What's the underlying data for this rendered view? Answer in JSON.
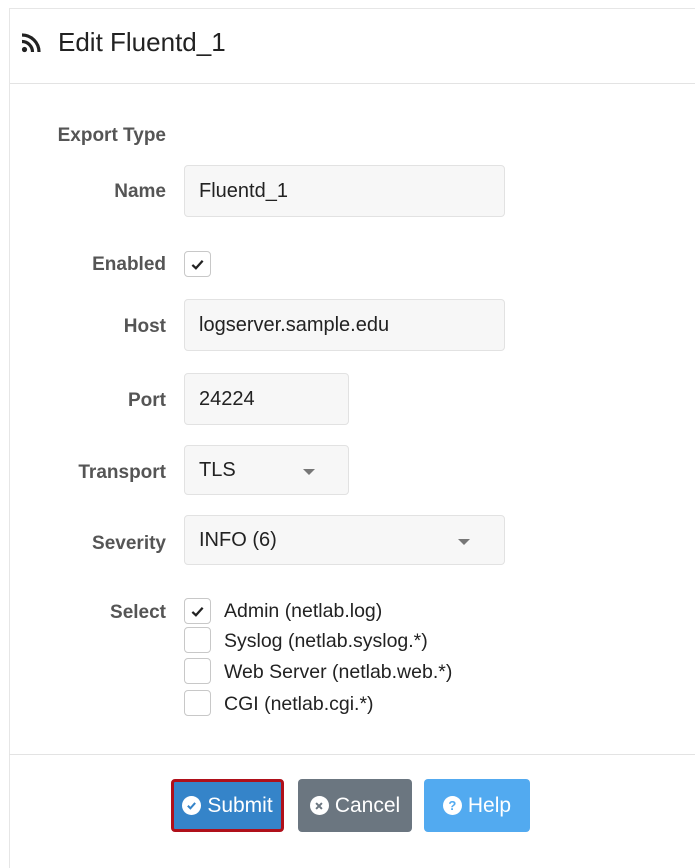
{
  "header": {
    "title": "Edit Fluentd_1",
    "icon": "rss-icon"
  },
  "form": {
    "export_type": {
      "label": "Export Type"
    },
    "name": {
      "label": "Name",
      "value": "Fluentd_1"
    },
    "enabled": {
      "label": "Enabled",
      "checked": true
    },
    "host": {
      "label": "Host",
      "value": "logserver.sample.edu"
    },
    "port": {
      "label": "Port",
      "value": "24224"
    },
    "transport": {
      "label": "Transport",
      "value": "TLS"
    },
    "severity": {
      "label": "Severity",
      "value": "INFO (6)"
    },
    "select": {
      "label": "Select",
      "options": [
        {
          "label": "Admin (netlab.log)",
          "checked": true
        },
        {
          "label": "Syslog (netlab.syslog.*)",
          "checked": false
        },
        {
          "label": "Web Server (netlab.web.*)",
          "checked": false
        },
        {
          "label": "CGI (netlab.cgi.*)",
          "checked": false
        }
      ]
    }
  },
  "buttons": {
    "submit": "Submit",
    "cancel": "Cancel",
    "help": "Help"
  },
  "colors": {
    "submit": "#3584c9",
    "submit_border": "#b0101a",
    "cancel": "#6b7680",
    "help": "#52aaf0"
  }
}
